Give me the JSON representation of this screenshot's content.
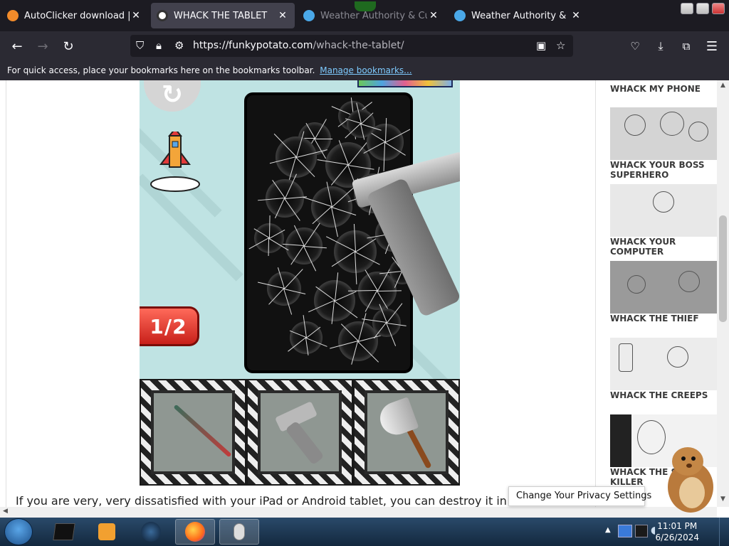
{
  "browser": {
    "tabs": [
      {
        "title": "AutoClicker download | Sour",
        "active": false
      },
      {
        "title": "WHACK THE TABLET",
        "active": true
      },
      {
        "title": "Weather Authority & Custo",
        "active": false
      },
      {
        "title": "Weather Authority & Custom",
        "active": false
      }
    ],
    "url_host": "https://funkypotato.com",
    "url_path": "/whack-the-tablet/",
    "bookmarks_text": "For quick access, place your bookmarks here on the bookmarks toolbar.",
    "bookmarks_link": "Manage bookmarks..."
  },
  "game": {
    "counter": "1/2",
    "tools": [
      {
        "name": "bat",
        "icon": "baseball-bat-icon"
      },
      {
        "name": "hammer",
        "icon": "hammer-gun-icon"
      },
      {
        "name": "axe",
        "icon": "axe-icon"
      }
    ]
  },
  "page": {
    "paragraph": "If you are very, very dissatisfied with your iPad or Android tablet, you can destroy it in many sophis"
  },
  "sidebar": {
    "items": [
      {
        "label": "WHACK MY PHONE"
      },
      {
        "label": "WHACK YOUR BOSS SUPERHERO"
      },
      {
        "label": "WHACK YOUR COMPUTER"
      },
      {
        "label": "WHACK THE THIEF"
      },
      {
        "label": "WHACK THE CREEPS"
      },
      {
        "label": "WHACK THE SERIAL KILLER"
      }
    ]
  },
  "privacy": {
    "label": "Change Your Privacy Settings"
  },
  "taskbar": {
    "time": "11:01 PM",
    "date": "6/26/2024"
  }
}
